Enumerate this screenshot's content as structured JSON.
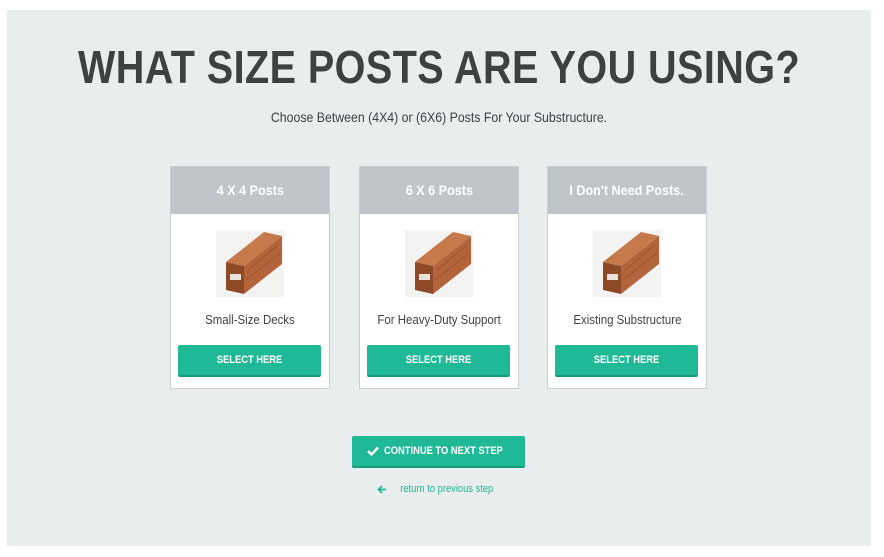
{
  "heading": "WHAT SIZE POSTS ARE YOU USING?",
  "subheading": "Choose Between (4X4) or (6X6) Posts For Your Substructure.",
  "cards": [
    {
      "title": "4 X 4 Posts",
      "description": "Small-Size Decks",
      "button": "SELECT HERE",
      "image_icon": "wood-post-image"
    },
    {
      "title": "6 X 6 Posts",
      "description": "For Heavy-Duty Support",
      "button": "SELECT HERE",
      "image_icon": "wood-post-image"
    },
    {
      "title": "I Don't Need Posts.",
      "description": "Existing Substructure",
      "button": "SELECT HERE",
      "image_icon": "wood-post-image"
    }
  ],
  "continue": {
    "label": "CONTINUE TO NEXT STEP",
    "icon": "check-icon"
  },
  "return": {
    "label": "return to previous step",
    "icon": "arrow-left-icon"
  },
  "colors": {
    "accent": "#1fb995",
    "background": "#e9edee",
    "card_header": "#bfc5c8",
    "heading_text": "#3d4141"
  }
}
